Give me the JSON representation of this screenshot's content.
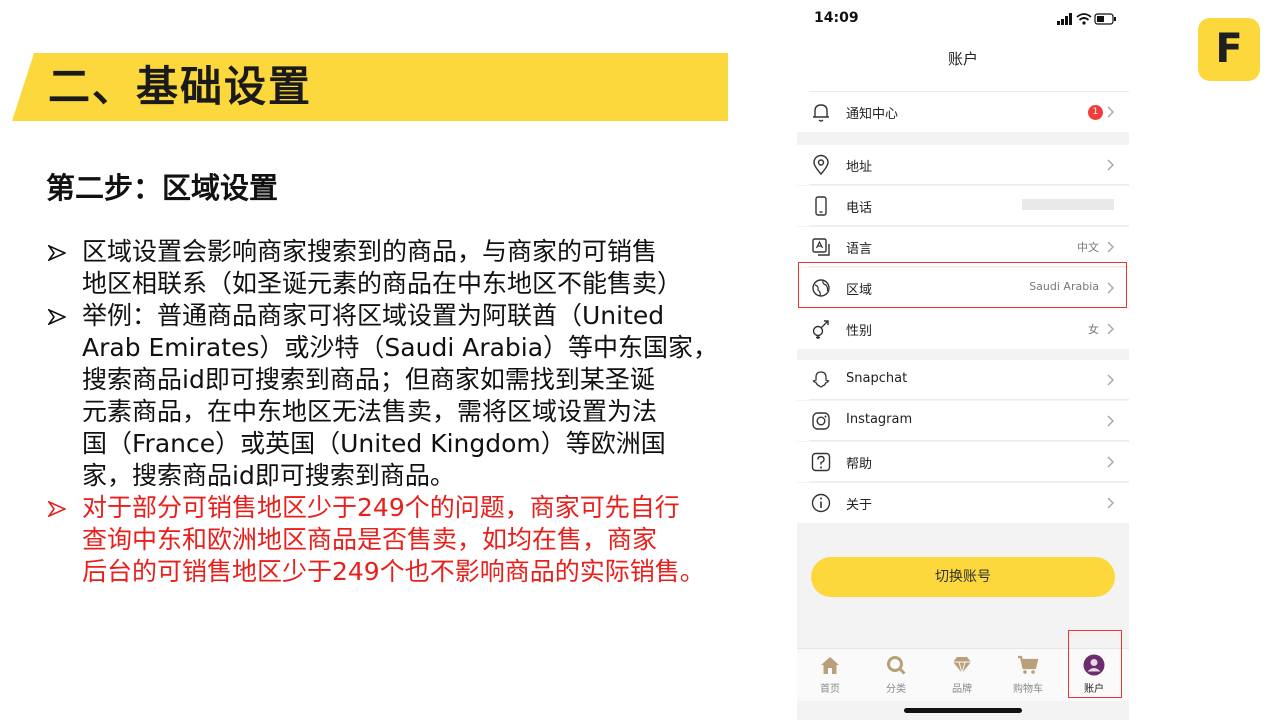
{
  "slide": {
    "title": "二、基础设置",
    "subtitle": "第二步：区域设置",
    "bullets": [
      {
        "lines": [
          "区域设置会影响商家搜索到的商品，与商家的可销售",
          "地区相联系（如圣诞元素的商品在中东地区不能售卖）"
        ],
        "color": "black"
      },
      {
        "lines": [
          "举例：普通商品商家可将区域设置为阿联酋（United",
          "Arab Emirates）或沙特（Saudi Arabia）等中东国家，",
          "搜索商品id即可搜索到商品；但商家如需找到某圣诞",
          "元素商品，在中东地区无法售卖，需将区域设置为法",
          "国（France）或英国（United Kingdom）等欧洲国",
          "家，搜索商品id即可搜索到商品。"
        ],
        "color": "black"
      },
      {
        "lines": [
          "对于部分可销售地区少于249个的问题，商家可先自行",
          "查询中东和欧洲地区商品是否售卖，如均在售，商家",
          "后台的可销售地区少于249个也不影响商品的实际销售。"
        ],
        "color": "red"
      }
    ],
    "logo_letter": "F",
    "colors": {
      "accent_yellow": "#fcd83c",
      "highlight_red": "#e33333",
      "text_red": "#e8201c"
    }
  },
  "phone": {
    "status": {
      "time": "14:09"
    },
    "nav_title": "账户",
    "rows": [
      {
        "icon": "bell-icon",
        "label": "通知中心",
        "badge": "1"
      },
      {
        "icon": "location-pin-icon",
        "label": "地址"
      },
      {
        "icon": "phone-icon",
        "label": "电话"
      },
      {
        "icon": "language-icon",
        "label": "语言",
        "value": "中文"
      },
      {
        "icon": "globe-icon",
        "label": "区域",
        "value": "Saudi Arabia"
      },
      {
        "icon": "gender-icon",
        "label": "性别",
        "value": "女"
      },
      {
        "icon": "snapchat-icon",
        "label": "Snapchat"
      },
      {
        "icon": "instagram-icon",
        "label": "Instagram"
      },
      {
        "icon": "help-icon",
        "label": "帮助"
      },
      {
        "icon": "info-icon",
        "label": "关于"
      }
    ],
    "switch_account": "切换账号",
    "tabs": [
      {
        "icon": "home-icon",
        "label": "首页"
      },
      {
        "icon": "search-icon",
        "label": "分类"
      },
      {
        "icon": "diamond-icon",
        "label": "品牌"
      },
      {
        "icon": "cart-icon",
        "label": "购物车"
      },
      {
        "icon": "avatar-icon",
        "label": "账户",
        "active": true
      }
    ]
  }
}
